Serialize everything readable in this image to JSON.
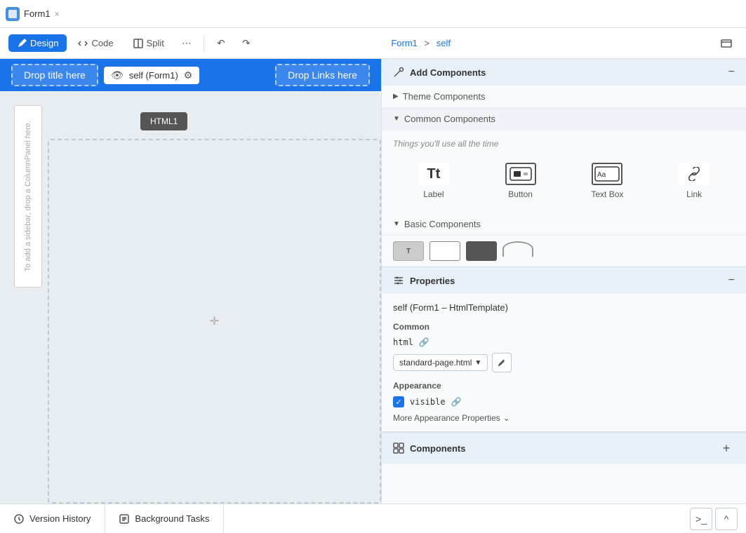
{
  "tab": {
    "title": "Form1",
    "close_label": "×"
  },
  "toolbar": {
    "design_label": "Design",
    "code_label": "Code",
    "split_label": "Split",
    "more_label": "⋯",
    "undo_label": "↶",
    "redo_label": "↷",
    "breadcrumb_form": "Form1",
    "breadcrumb_arrow": ">",
    "breadcrumb_page": "self"
  },
  "canvas": {
    "drop_title": "Drop title here",
    "selector_text": "self (Form1)",
    "drop_links": "Drop Links here",
    "html_btn": "HTML1",
    "column_panel_text": "To add a sidebar, drop a ColumnPanel here."
  },
  "add_components": {
    "section_title": "Add Components",
    "theme_components_label": "Theme Components",
    "common_components_label": "Common Components",
    "common_hint": "Things you'll use all the time",
    "components": [
      {
        "label": "Label",
        "icon_text": "Tt",
        "type": "text"
      },
      {
        "label": "Button",
        "icon_text": "☐",
        "type": "button"
      },
      {
        "label": "Text Box",
        "icon_text": "▭",
        "type": "textbox"
      },
      {
        "label": "Link",
        "icon_text": "🔗",
        "type": "link"
      }
    ],
    "basic_components_label": "Basic Components"
  },
  "properties": {
    "section_title": "Properties",
    "component_name": "self (Form1 – HtmlTemplate)",
    "common_label": "Common",
    "html_prop_name": "html",
    "html_value": "standard-page.html",
    "appearance_label": "Appearance",
    "visible_label": "visible",
    "more_appearance_label": "More Appearance Properties",
    "chevron_down": "⌄"
  },
  "components_bottom": {
    "section_title": "Components"
  },
  "bottom_bar": {
    "version_history_label": "Version History",
    "background_tasks_label": "Background Tasks",
    "terminal_icon": ">_",
    "chevron_up": "^"
  }
}
